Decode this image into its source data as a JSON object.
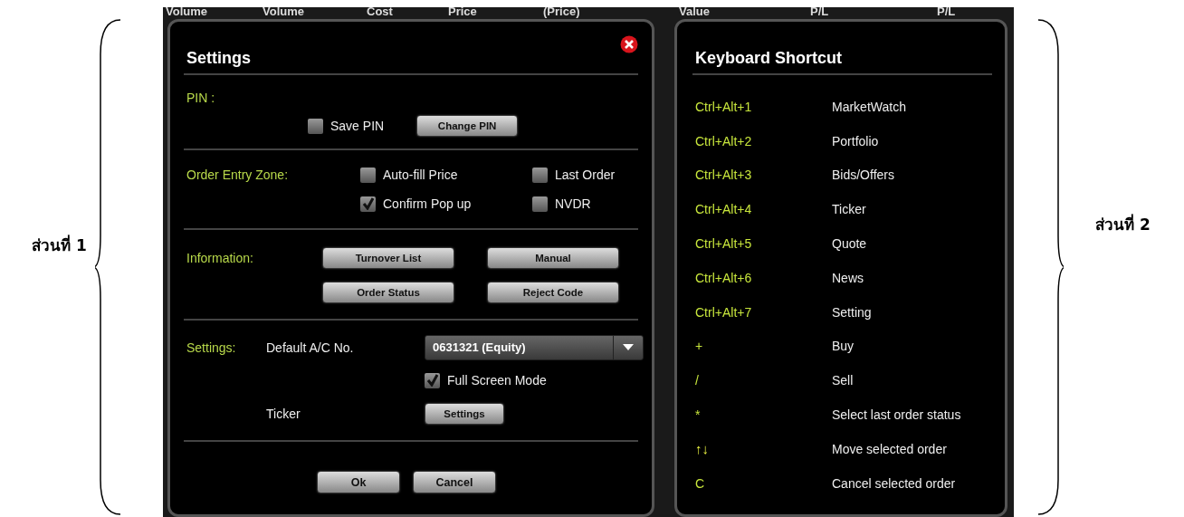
{
  "left_caption": "ส่วนที่ 1",
  "right_caption": "ส่วนที่ 2",
  "background_header": [
    "Volume",
    "Volume",
    "Cost",
    "Price",
    "(Price)",
    "Value",
    "P/L",
    "P/L"
  ],
  "settings_dialog": {
    "title": "Settings",
    "pin": {
      "label": "PIN :",
      "save_pin": {
        "label": "Save PIN",
        "checked": false
      },
      "button": "Change PIN"
    },
    "order_entry": {
      "label": "Order Entry Zone:",
      "options": [
        {
          "label": "Auto-fill Price",
          "checked": false
        },
        {
          "label": "Last Order",
          "checked": false
        },
        {
          "label": "Confirm Pop up",
          "checked": true
        },
        {
          "label": "NVDR",
          "checked": false
        }
      ]
    },
    "information": {
      "label": "Information:",
      "buttons": [
        "Turnover List",
        "Manual",
        "Order Status",
        "Reject Code"
      ]
    },
    "settings": {
      "label": "Settings:",
      "default_ac_label": "Default A/C No.",
      "default_ac_value": "0631321 (Equity)",
      "full_screen": {
        "label": "Full Screen Mode",
        "checked": true
      },
      "ticker_label": "Ticker",
      "ticker_button": "Settings"
    },
    "buttons": [
      "Ok",
      "Cancel"
    ]
  },
  "shortcut_dialog": {
    "title": "Keyboard Shortcut",
    "rows": [
      {
        "key": "Ctrl+Alt+1",
        "action": "MarketWatch",
        "kind": "text"
      },
      {
        "key": "Ctrl+Alt+2",
        "action": "Portfolio",
        "kind": "text"
      },
      {
        "key": "Ctrl+Alt+3",
        "action": "Bids/Offers",
        "kind": "text"
      },
      {
        "key": "Ctrl+Alt+4",
        "action": "Ticker",
        "kind": "text"
      },
      {
        "key": "Ctrl+Alt+5",
        "action": "Quote",
        "kind": "text"
      },
      {
        "key": "Ctrl+Alt+6",
        "action": "News",
        "kind": "text"
      },
      {
        "key": "Ctrl+Alt+7",
        "action": "Setting",
        "kind": "text"
      },
      {
        "key": "+",
        "action": "Buy",
        "kind": "text"
      },
      {
        "key": "/",
        "action": "Sell",
        "kind": "text"
      },
      {
        "key": "*",
        "action": "Select last order status",
        "kind": "text"
      },
      {
        "key": "↑↓",
        "action": "Move selected order",
        "kind": "arrows"
      },
      {
        "key": "C",
        "action": "Cancel selected order",
        "kind": "text"
      }
    ]
  }
}
